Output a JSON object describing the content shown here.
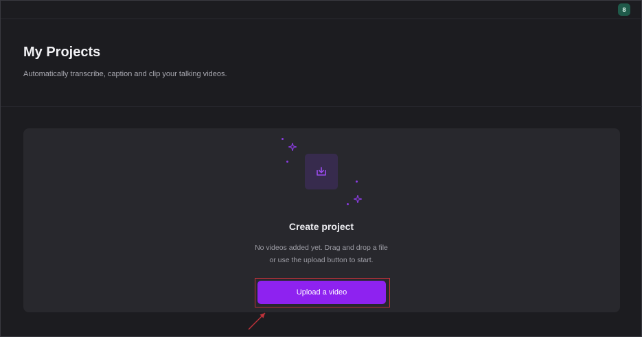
{
  "header": {
    "avatar_initials": "8",
    "avatar_color": "#1f5a4a"
  },
  "page": {
    "title": "My Projects",
    "subtitle": "Automatically transcribe, caption and clip your talking videos."
  },
  "empty_state": {
    "icon": "download-tray-icon",
    "title": "Create project",
    "description": "No videos added yet. Drag and drop a file or use the upload button to start.",
    "upload_button_label": "Upload a video",
    "accent_color": "#8e22f0"
  },
  "annotation": {
    "highlight_color": "#c0323a",
    "target": "upload-video-button"
  }
}
